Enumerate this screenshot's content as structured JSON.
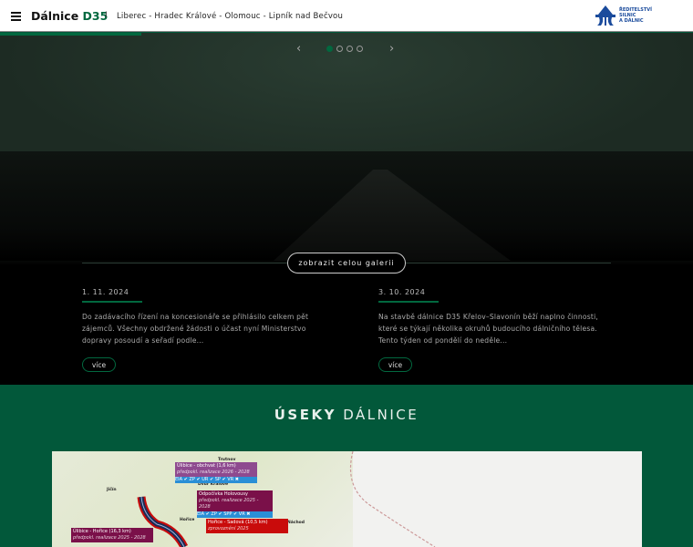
{
  "header": {
    "brand_prefix": "Dálnice",
    "brand_suffix": "D35",
    "separator": "I",
    "route": "Liberec - Hradec Králové - Olomouc - Lipník nad Bečvou",
    "logo_text": [
      "ŘEDITELSTVÍ",
      "SILNIC",
      "A DÁLNIC"
    ]
  },
  "hero": {
    "prev_icon": "‹",
    "next_icon": "›",
    "slides_total": 4,
    "active_slide": 1,
    "gallery_button": "zobrazit celou galerii"
  },
  "news": [
    {
      "date": "1. 11. 2024",
      "text": "Do zadávacího řízení na koncesionáře se přihlásilo celkem pět zájemců. Všechny obdržené žádosti o účast nyní Ministerstvo dopravy posoudí a seřadí podle...",
      "more": "více"
    },
    {
      "date": "3. 10. 2024",
      "text": "Na stavbě dálnice D35 Křelov–Slavonín běží naplno činnosti, které se týkají několika okruhů budoucího dálničního tělesa. Tento týden od pondělí do neděle...",
      "more": "více"
    }
  ],
  "sections": {
    "title_bold": "ÚSEKY",
    "title_light": "DÁLNICE"
  },
  "map": {
    "labels": [
      {
        "title": "Úlibice - obchvat (1,6 km)",
        "sub": "předpokl. realizace 2026 - 2028",
        "status": "EIA ✔ ZP ✔ UR ✔ SP ✔ VR ✖"
      },
      {
        "title": "Odpočívka Holovousy",
        "sub": "předpokl. realizace 2025 - 2028",
        "status": "EIA ✔ ZP ✔ SPP ✔ VR ✖"
      },
      {
        "title": "Hořice - Sadová (10,5 km)",
        "sub": "zprovoznění 2025"
      },
      {
        "title": "Úlibice - Hořice (16,3 km)",
        "sub": "předpokl. realizace 2025 - 2028"
      }
    ],
    "places": [
      "Trutnov",
      "Jičín",
      "Dvůr Králové",
      "Hořice",
      "Náchod"
    ],
    "colors": {
      "purple": "#8e4a8f",
      "maroon": "#7a1049",
      "red": "#c90b0b",
      "blue": "#2a8fd6"
    }
  }
}
